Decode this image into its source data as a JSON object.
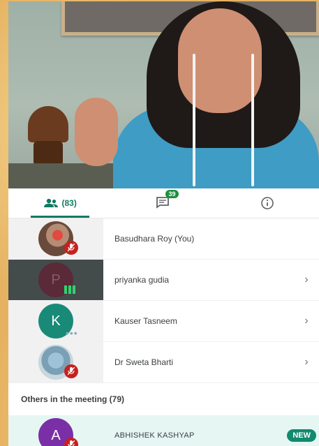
{
  "tabs": {
    "people_count": "(83)",
    "chat_count": "39"
  },
  "participants": [
    {
      "name": "Basudhara Roy (You)",
      "mic": "muted",
      "avatar": "photo"
    },
    {
      "name": "priyanka gudia",
      "initial": "P",
      "mic": "speaking"
    },
    {
      "name": "Kauser Tasneem",
      "initial": "K",
      "mic": "idle"
    },
    {
      "name": "Dr Sweta Bharti",
      "mic": "muted",
      "avatar": "photo"
    }
  ],
  "others": {
    "header": "Others in the meeting (79)",
    "items": [
      {
        "name": "ABHISHEK KASHYAP",
        "initial": "A",
        "badge": "NEW",
        "mic": "muted"
      }
    ]
  },
  "colors": {
    "accent": "#0f7a63",
    "mic_muted": "#c5221f",
    "speaking": "#2fd36f",
    "new_badge": "#128a6e"
  }
}
